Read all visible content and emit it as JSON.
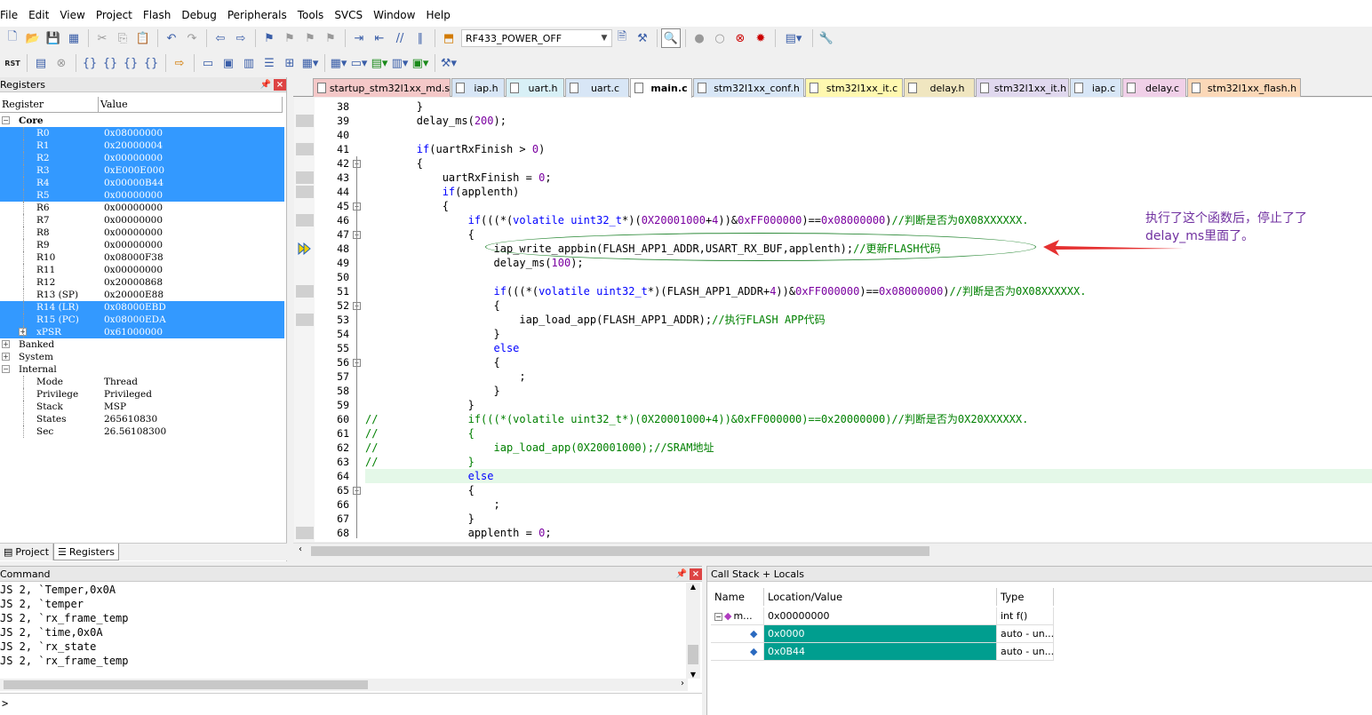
{
  "menu": [
    "File",
    "Edit",
    "View",
    "Project",
    "Flash",
    "Debug",
    "Peripherals",
    "Tools",
    "SVCS",
    "Window",
    "Help"
  ],
  "toolbar": {
    "target": "RF433_POWER_OFF"
  },
  "toolbar2": {
    "reset_label": "RST"
  },
  "registers": {
    "title": "Registers",
    "col_register": "Register",
    "col_value": "Value",
    "core_label": "Core",
    "core": [
      {
        "name": "R0",
        "value": "0x08000000",
        "sel": true
      },
      {
        "name": "R1",
        "value": "0x20000004",
        "sel": true
      },
      {
        "name": "R2",
        "value": "0x00000000",
        "sel": true
      },
      {
        "name": "R3",
        "value": "0xE000E000",
        "sel": true
      },
      {
        "name": "R4",
        "value": "0x00000B44",
        "sel": true
      },
      {
        "name": "R5",
        "value": "0x00000000",
        "sel": true
      },
      {
        "name": "R6",
        "value": "0x00000000",
        "sel": false
      },
      {
        "name": "R7",
        "value": "0x00000000",
        "sel": false
      },
      {
        "name": "R8",
        "value": "0x00000000",
        "sel": false
      },
      {
        "name": "R9",
        "value": "0x00000000",
        "sel": false
      },
      {
        "name": "R10",
        "value": "0x08000F38",
        "sel": false
      },
      {
        "name": "R11",
        "value": "0x00000000",
        "sel": false
      },
      {
        "name": "R12",
        "value": "0x20000868",
        "sel": false
      },
      {
        "name": "R13 (SP)",
        "value": "0x20000E88",
        "sel": false
      },
      {
        "name": "R14 (LR)",
        "value": "0x08000EBD",
        "sel": true
      },
      {
        "name": "R15 (PC)",
        "value": "0x08000EDA",
        "sel": true
      },
      {
        "name": "xPSR",
        "value": "0x61000000",
        "sel": true
      }
    ],
    "groups": [
      "Banked",
      "System",
      "Internal"
    ],
    "internal": [
      {
        "name": "Mode",
        "value": "Thread"
      },
      {
        "name": "Privilege",
        "value": "Privileged"
      },
      {
        "name": "Stack",
        "value": "MSP"
      },
      {
        "name": "States",
        "value": "265610830"
      },
      {
        "name": "Sec",
        "value": "26.56108300"
      }
    ],
    "tab_project": "Project",
    "tab_registers": "Registers"
  },
  "editor_tabs": [
    "startup_stm32l1xx_md.s",
    "iap.h",
    "uart.h",
    "uart.c",
    "main.c",
    "stm32l1xx_conf.h",
    "stm32l1xx_it.c",
    "delay.h",
    "stm32l1xx_it.h",
    "iap.c",
    "delay.c",
    "stm32l1xx_flash.h"
  ],
  "code_lines": [
    {
      "n": "38",
      "t": "        }"
    },
    {
      "n": "39",
      "t": "        delay_ms(200);"
    },
    {
      "n": "40",
      "t": ""
    },
    {
      "n": "41",
      "t": "        if(uartRxFinish > 0)"
    },
    {
      "n": "42",
      "t": "        {"
    },
    {
      "n": "43",
      "t": "            uartRxFinish = 0;"
    },
    {
      "n": "44",
      "t": "            if(applenth)"
    },
    {
      "n": "45",
      "t": "            {"
    },
    {
      "n": "46",
      "t": "                if(((*(volatile uint32_t*)(0X20001000+4))&0xFF000000)==0x08000000)//判断是否为0X08XXXXXX."
    },
    {
      "n": "47",
      "t": "                {"
    },
    {
      "n": "48",
      "t": "                    iap_write_appbin(FLASH_APP1_ADDR,USART_RX_BUF,applenth);//更新FLASH代码"
    },
    {
      "n": "49",
      "t": "                    delay_ms(100);"
    },
    {
      "n": "50",
      "t": ""
    },
    {
      "n": "51",
      "t": "                    if(((*(volatile uint32_t*)(FLASH_APP1_ADDR+4))&0xFF000000)==0x08000000)//判断是否为0X08XXXXXX."
    },
    {
      "n": "52",
      "t": "                    {"
    },
    {
      "n": "53",
      "t": "                        iap_load_app(FLASH_APP1_ADDR);//执行FLASH APP代码"
    },
    {
      "n": "54",
      "t": "                    }"
    },
    {
      "n": "55",
      "t": "                    else"
    },
    {
      "n": "56",
      "t": "                    {"
    },
    {
      "n": "57",
      "t": "                        ;"
    },
    {
      "n": "58",
      "t": "                    }"
    },
    {
      "n": "59",
      "t": "                }"
    },
    {
      "n": "60",
      "t": "//              if(((*(volatile uint32_t*)(0X20001000+4))&0xFF000000)==0x20000000)//判断是否为0X20XXXXXX."
    },
    {
      "n": "61",
      "t": "//              {"
    },
    {
      "n": "62",
      "t": "//                  iap_load_app(0X20001000);//SRAM地址"
    },
    {
      "n": "63",
      "t": "//              }"
    },
    {
      "n": "64",
      "t": "                else"
    },
    {
      "n": "65",
      "t": "                {"
    },
    {
      "n": "66",
      "t": "                    ;"
    },
    {
      "n": "67",
      "t": "                }"
    },
    {
      "n": "68",
      "t": "                applenth = 0;"
    }
  ],
  "annotation": {
    "line1": "执行了这个函数后，停止了了",
    "line2": "delay_ms里面了。"
  },
  "command": {
    "title": "Command",
    "lines": [
      "JS 2, `Temper,0x0A",
      "JS 2, `temper",
      "JS 2, `rx_frame_temp",
      "JS 2, `time,0x0A",
      "JS 2, `rx_state",
      "JS 2, `rx_frame_temp"
    ],
    "prompt": ">"
  },
  "callstack": {
    "title": "Call Stack + Locals",
    "col_name": "Name",
    "col_location": "Location/Value",
    "col_type": "Type",
    "rows": [
      {
        "name": "m...",
        "location": "0x00000000",
        "type": "int f()"
      },
      {
        "name": "",
        "location": "0x0000",
        "type": "auto - un..."
      },
      {
        "name": "",
        "location": "0x0B44",
        "type": "auto - un..."
      }
    ]
  }
}
